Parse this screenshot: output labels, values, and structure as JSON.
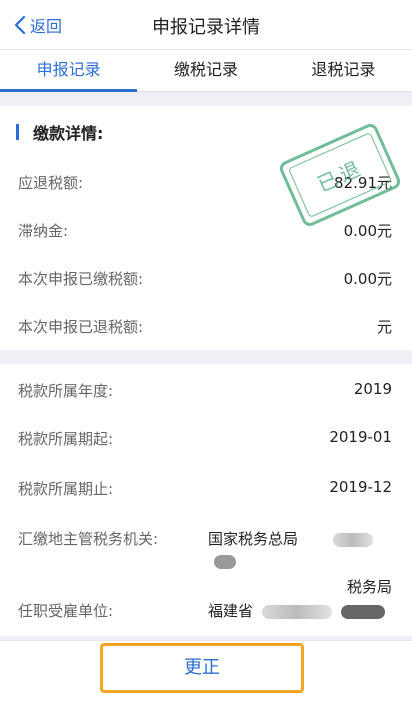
{
  "nav": {
    "back_label": "返回",
    "title": "申报记录详情"
  },
  "tabs": [
    {
      "label": "申报记录",
      "active": true
    },
    {
      "label": "缴税记录",
      "active": false
    },
    {
      "label": "退税记录",
      "active": false
    }
  ],
  "section1": {
    "title": "缴款详情:",
    "stamp_text": "已退",
    "rows": [
      {
        "label": "应退税额:",
        "value": "82.91元"
      },
      {
        "label": "滞纳金:",
        "value": "0.00元"
      },
      {
        "label": "本次申报已缴税额:",
        "value": "0.00元"
      },
      {
        "label": "本次申报已退税额:",
        "value": "元"
      }
    ]
  },
  "section2": {
    "rows": [
      {
        "label": "税款所属年度:",
        "value": "2019"
      },
      {
        "label": "税款所属期起:",
        "value": "2019-01"
      },
      {
        "label": "税款所属期止:",
        "value": "2019-12"
      }
    ],
    "authority": {
      "label": "汇缴地主管税务机关:",
      "value_line1": "国家税务总局",
      "value_line2": "税务局"
    },
    "employer": {
      "label": "任职受雇单位:",
      "value": "福建省"
    }
  },
  "footer": {
    "button_label": "更正"
  },
  "colors": {
    "accent": "#2b6fd6",
    "stamp": "#58b286",
    "highlight": "#f5a524"
  }
}
